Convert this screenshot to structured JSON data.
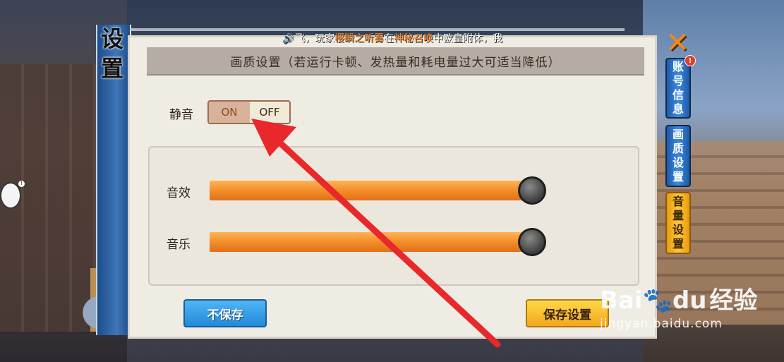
{
  "title_chars": [
    "设",
    "置"
  ],
  "notice": {
    "prefix": "飞，玩家",
    "player": "樱瞬之听雾",
    "mid1": "在",
    "event": "神秘召唤",
    "suffix": "中欧皇附体，我"
  },
  "header_text": "画质设置（若运行卡顿、发热量和耗电量过大可适当降低）",
  "mute": {
    "label": "静音",
    "on": "ON",
    "off": "OFF",
    "selected": "ON"
  },
  "sliders": [
    {
      "label": "音效",
      "level": 1.0
    },
    {
      "label": "音乐",
      "level": 1.0
    }
  ],
  "buttons": {
    "no_save": "不保存",
    "save": "保存设置"
  },
  "close_symbol": "✕",
  "tabs": [
    {
      "label": [
        "账",
        "号",
        "信",
        "息"
      ],
      "active": false,
      "badge": "!"
    },
    {
      "label": [
        "画",
        "质",
        "设",
        "置"
      ],
      "active": false
    },
    {
      "label": [
        "音",
        "量",
        "设",
        "置"
      ],
      "active": true
    }
  ],
  "watermark": {
    "brand": "Bai",
    "brand2": "du",
    "cn": "经验",
    "url": "jingyan.baidu.com"
  },
  "colors": {
    "accent_orange": "#f08a26",
    "tab_blue": "#3d8ae0",
    "tab_gold": "#ffc83a",
    "arrow_red": "#e8282a"
  }
}
